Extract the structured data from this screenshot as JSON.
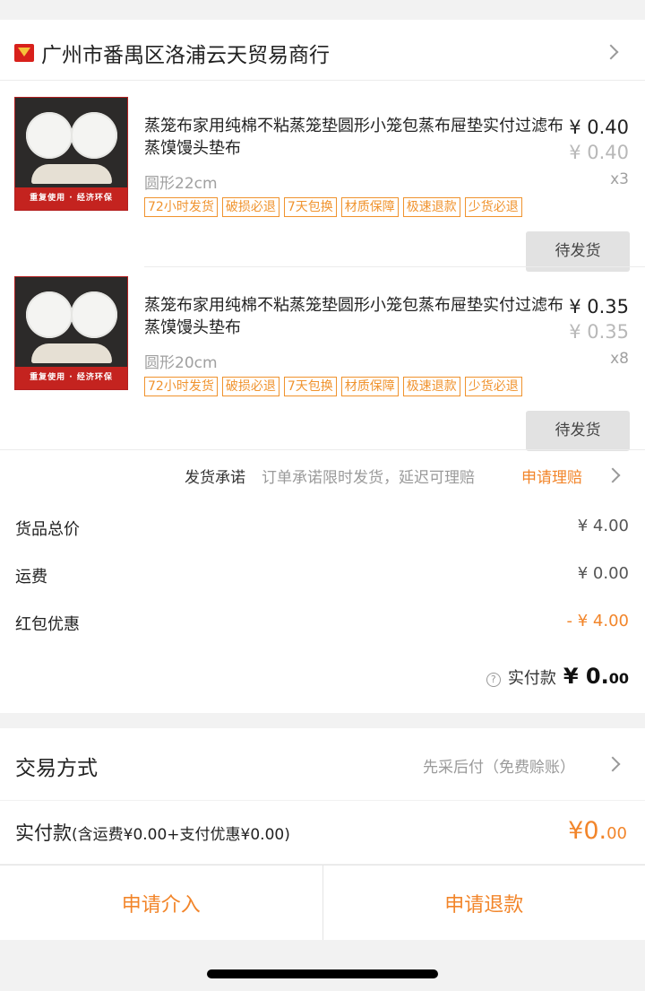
{
  "shop": {
    "name": "广州市番禺区洛浦云天贸易商行"
  },
  "items": [
    {
      "title": "蒸笼布家用纯棉不粘蒸笼垫圆形小笼包蒸布屉垫实付过滤布蒸馍馒头垫布",
      "price": "¥ 0.40",
      "original_price": "¥ 0.40",
      "spec": "圆形22cm",
      "qty": "x3",
      "image_banner": "重复使用 · 经济环保",
      "tags": [
        "72小时发货",
        "破损必退",
        "7天包换",
        "材质保障",
        "极速退款",
        "少货必退"
      ],
      "status": "待发货"
    },
    {
      "title": "蒸笼布家用纯棉不粘蒸笼垫圆形小笼包蒸布屉垫实付过滤布蒸馍馒头垫布",
      "price": "¥ 0.35",
      "original_price": "¥ 0.35",
      "spec": "圆形20cm",
      "qty": "x8",
      "image_banner": "重复使用 · 经济环保",
      "tags": [
        "72小时发货",
        "破损必退",
        "7天包换",
        "材质保障",
        "极速退款",
        "少货必退"
      ],
      "status": "待发货"
    }
  ],
  "promise": {
    "label": "发货承诺",
    "desc": "订单承诺限时发货，延迟可理赔",
    "link": "申请理赔"
  },
  "summary": {
    "goods_label": "货品总价",
    "goods_value": "¥ 4.00",
    "shipping_label": "运费",
    "shipping_value": "¥ 0.00",
    "coupon_label": "红包优惠",
    "coupon_value": "- ¥ 4.00",
    "paid_label": "实付款",
    "paid_currency": "¥",
    "paid_int": "0.",
    "paid_dec": "00"
  },
  "trade": {
    "label": "交易方式",
    "value": "先采后付（免费赊账）"
  },
  "total": {
    "label": "实付款",
    "sub": "(含运费¥0.00+支付优惠¥0.00)",
    "currency_int": "¥0.",
    "dec": "00"
  },
  "actions": {
    "intervene": "申请介入",
    "refund": "申请退款"
  },
  "colors": {
    "accent": "#f2852a",
    "brand_red": "#d8201b"
  }
}
